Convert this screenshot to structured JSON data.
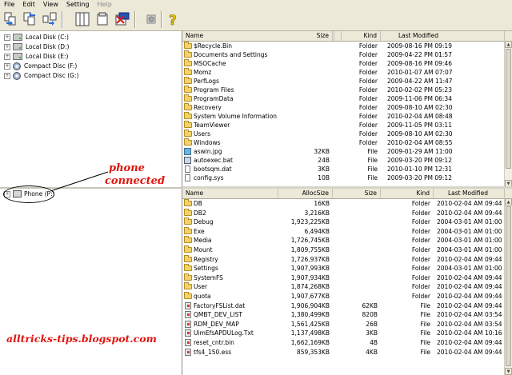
{
  "menu": [
    "File",
    "Edit",
    "View",
    "Setting",
    "Help"
  ],
  "tree_top": [
    {
      "label": "Local Disk (C:)",
      "icon": "drive-icon"
    },
    {
      "label": "Local Disk (D:)",
      "icon": "drive-icon"
    },
    {
      "label": "Local Disk (E:)",
      "icon": "drive-icon"
    },
    {
      "label": "Compact Disc (F:)",
      "icon": "cd-icon"
    },
    {
      "label": "Compact Disc (G:)",
      "icon": "cd-icon"
    }
  ],
  "tree_bottom": [
    {
      "label": "Phone (P:)",
      "icon": "phone-icon"
    }
  ],
  "top_list": {
    "headers": {
      "name": "Name",
      "size": "Size",
      "kind": "Kind",
      "modified": "Last Modified"
    },
    "rows": [
      {
        "name": "$Recycle.Bin",
        "size": "",
        "kind": "Folder",
        "modified": "2009-08-16 PM 09:19",
        "icon": "folder"
      },
      {
        "name": "Documents and Settings",
        "size": "",
        "kind": "Folder",
        "modified": "2009-04-22 PM 01:57",
        "icon": "folder"
      },
      {
        "name": "MSOCache",
        "size": "",
        "kind": "Folder",
        "modified": "2009-08-16 PM 09:46",
        "icon": "folder"
      },
      {
        "name": "Momz",
        "size": "",
        "kind": "Folder",
        "modified": "2010-01-07 AM 07:07",
        "icon": "folder"
      },
      {
        "name": "PerfLogs",
        "size": "",
        "kind": "Folder",
        "modified": "2009-04-22 AM 11:47",
        "icon": "folder"
      },
      {
        "name": "Program Files",
        "size": "",
        "kind": "Folder",
        "modified": "2010-02-02 PM 05:23",
        "icon": "folder"
      },
      {
        "name": "ProgramData",
        "size": "",
        "kind": "Folder",
        "modified": "2009-11-06 PM 06:34",
        "icon": "folder"
      },
      {
        "name": "Recovery",
        "size": "",
        "kind": "Folder",
        "modified": "2009-08-10 AM 02:30",
        "icon": "folder"
      },
      {
        "name": "System Volume Information",
        "size": "",
        "kind": "Folder",
        "modified": "2010-02-04 AM 08:48",
        "icon": "folder"
      },
      {
        "name": "TeamViewer",
        "size": "",
        "kind": "Folder",
        "modified": "2009-11-05 PM 03:11",
        "icon": "folder"
      },
      {
        "name": "Users",
        "size": "",
        "kind": "Folder",
        "modified": "2009-08-10 AM 02:30",
        "icon": "folder"
      },
      {
        "name": "Windows",
        "size": "",
        "kind": "Folder",
        "modified": "2010-02-04 AM 08:55",
        "icon": "folder"
      },
      {
        "name": "aswin.jpg",
        "size": "32KB",
        "kind": "File",
        "modified": "2009-01-29 AM 11:00",
        "icon": "img"
      },
      {
        "name": "autoexec.bat",
        "size": "24B",
        "kind": "File",
        "modified": "2009-03-20 PM 09:12",
        "icon": "bat"
      },
      {
        "name": "bootsqm.dat",
        "size": "3KB",
        "kind": "File",
        "modified": "2010-01-10 PM 12:31",
        "icon": "file"
      },
      {
        "name": "config.sys",
        "size": "10B",
        "kind": "File",
        "modified": "2009-03-20 PM 09:12",
        "icon": "file"
      }
    ]
  },
  "bottom_list": {
    "headers": {
      "name": "Name",
      "alloc": "AllocSize",
      "size": "Size",
      "kind": "Kind",
      "modified": "Last Modified"
    },
    "rows": [
      {
        "name": "DB",
        "alloc": "16KB",
        "size": "",
        "kind": "Folder",
        "modified": "2010-02-04 AM 09:44",
        "icon": "folder"
      },
      {
        "name": "DB2",
        "alloc": "3,216KB",
        "size": "",
        "kind": "Folder",
        "modified": "2010-02-04 AM 09:44",
        "icon": "folder"
      },
      {
        "name": "Debug",
        "alloc": "1,923,225KB",
        "size": "",
        "kind": "Folder",
        "modified": "2004-03-01 AM 01:00",
        "icon": "folder"
      },
      {
        "name": "Exe",
        "alloc": "6,494KB",
        "size": "",
        "kind": "Folder",
        "modified": "2004-03-01 AM 01:00",
        "icon": "folder"
      },
      {
        "name": "Media",
        "alloc": "1,726,745KB",
        "size": "",
        "kind": "Folder",
        "modified": "2004-03-01 AM 01:00",
        "icon": "folder"
      },
      {
        "name": "Mount",
        "alloc": "1,809,755KB",
        "size": "",
        "kind": "Folder",
        "modified": "2004-03-01 AM 01:00",
        "icon": "folder"
      },
      {
        "name": "Registry",
        "alloc": "1,726,937KB",
        "size": "",
        "kind": "Folder",
        "modified": "2010-02-04 AM 09:44",
        "icon": "folder"
      },
      {
        "name": "Settings",
        "alloc": "1,907,993KB",
        "size": "",
        "kind": "Folder",
        "modified": "2004-03-01 AM 01:00",
        "icon": "folder"
      },
      {
        "name": "SystemFS",
        "alloc": "1,907,934KB",
        "size": "",
        "kind": "Folder",
        "modified": "2010-02-04 AM 09:44",
        "icon": "folder"
      },
      {
        "name": "User",
        "alloc": "1,874,268KB",
        "size": "",
        "kind": "Folder",
        "modified": "2010-02-04 AM 09:44",
        "icon": "folder"
      },
      {
        "name": "quota",
        "alloc": "1,907,677KB",
        "size": "",
        "kind": "Folder",
        "modified": "2010-02-04 AM 09:44",
        "icon": "folder"
      },
      {
        "name": "FactoryFSList.dat",
        "alloc": "1,906,904KB",
        "size": "62KB",
        "kind": "File",
        "modified": "2010-02-04 AM 09:44",
        "icon": "sys"
      },
      {
        "name": "QMBT_DEV_LIST",
        "alloc": "1,380,499KB",
        "size": "820B",
        "kind": "File",
        "modified": "2010-02-04 AM 03:54",
        "icon": "sys"
      },
      {
        "name": "RDM_DEV_MAP",
        "alloc": "1,561,425KB",
        "size": "26B",
        "kind": "File",
        "modified": "2010-02-04 AM 03:54",
        "icon": "sys"
      },
      {
        "name": "UimEfsAPDULog.Txt",
        "alloc": "1,137,498KB",
        "size": "3KB",
        "kind": "File",
        "modified": "2010-02-04 AM 10:16",
        "icon": "sys"
      },
      {
        "name": "reset_cntr.bin",
        "alloc": "1,662,169KB",
        "size": "4B",
        "kind": "File",
        "modified": "2010-02-04 AM 09:44",
        "icon": "sys"
      },
      {
        "name": "tfs4_150.ess",
        "alloc": "859,353KB",
        "size": "4KB",
        "kind": "File",
        "modified": "2010-02-04 AM 09:44",
        "icon": "sys"
      }
    ]
  },
  "annotation": {
    "line1": "phone",
    "line2": "connected",
    "watermark": "alltricks-tips.blogspot.com"
  },
  "colors": {
    "annotation_red": "#e0150f",
    "chrome": "#ece9d8",
    "folder": "#f2d36b"
  }
}
